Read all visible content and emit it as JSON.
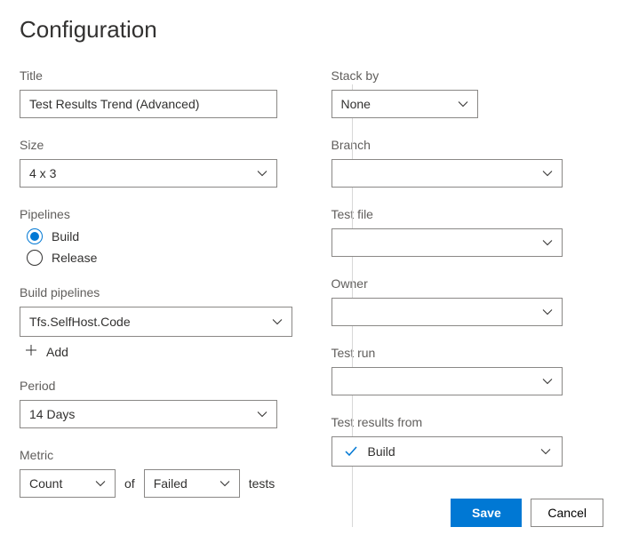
{
  "heading": "Configuration",
  "left": {
    "title_label": "Title",
    "title_value": "Test Results Trend (Advanced)",
    "size_label": "Size",
    "size_value": "4 x 3",
    "pipelines_label": "Pipelines",
    "pipeline_option_build": "Build",
    "pipeline_option_release": "Release",
    "build_pipelines_label": "Build pipelines",
    "build_pipelines_value": "Tfs.SelfHost.Code",
    "add_label": "Add",
    "period_label": "Period",
    "period_value": "14 Days",
    "metric_label": "Metric",
    "metric_count": "Count",
    "metric_of": "of",
    "metric_failed": "Failed",
    "metric_tests": "tests"
  },
  "right": {
    "stack_by_label": "Stack by",
    "stack_by_value": "None",
    "branch_label": "Branch",
    "branch_value": "",
    "test_file_label": "Test file",
    "test_file_value": "",
    "owner_label": "Owner",
    "owner_value": "",
    "test_run_label": "Test run",
    "test_run_value": "",
    "test_results_from_label": "Test results from",
    "test_results_from_value": "Build"
  },
  "buttons": {
    "save": "Save",
    "cancel": "Cancel"
  }
}
